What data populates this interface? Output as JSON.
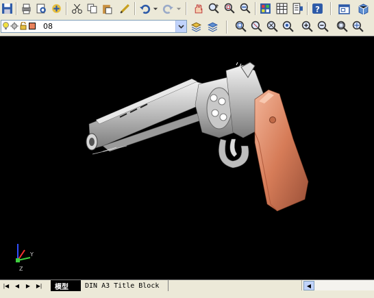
{
  "toolbar": {
    "row1_icons": [
      "save-icon",
      "print-icon",
      "print-preview-icon",
      "publish-icon",
      "cut-icon",
      "copy-icon",
      "paste-icon",
      "match-properties-icon",
      "undo-icon",
      "undo-dropdown-icon",
      "redo-icon",
      "redo-dropdown-icon",
      "pan-icon",
      "zoom-realtime-icon",
      "zoom-window-icon",
      "zoom-previous-icon",
      "properties-icon",
      "design-center-icon",
      "tool-palettes-icon",
      "help-icon",
      "viewport-icon",
      "3d-view-icon"
    ],
    "row2_icons": [
      "layer-state-icon",
      "layer-previous-icon",
      "zoom-extents-icon",
      "zoom-window2-icon",
      "zoom-dynamic-icon",
      "zoom-scale-icon",
      "zoom-center-icon",
      "zoom-in-icon",
      "zoom-out-icon",
      "zoom-all-icon",
      "zoom-object-icon"
    ]
  },
  "layer": {
    "current": "08",
    "icons": [
      "bulb-on-icon",
      "sun-icon",
      "lock-icon",
      "color-swatch-icon"
    ],
    "color": "#E8825C"
  },
  "ucs": {
    "x_label": "Y",
    "y_label": "Z"
  },
  "tabs": {
    "model": "模型",
    "layout": "DIN A3 Title Block"
  },
  "colors": {
    "grip": "#E59A78",
    "metal": "#c8c8c8"
  }
}
